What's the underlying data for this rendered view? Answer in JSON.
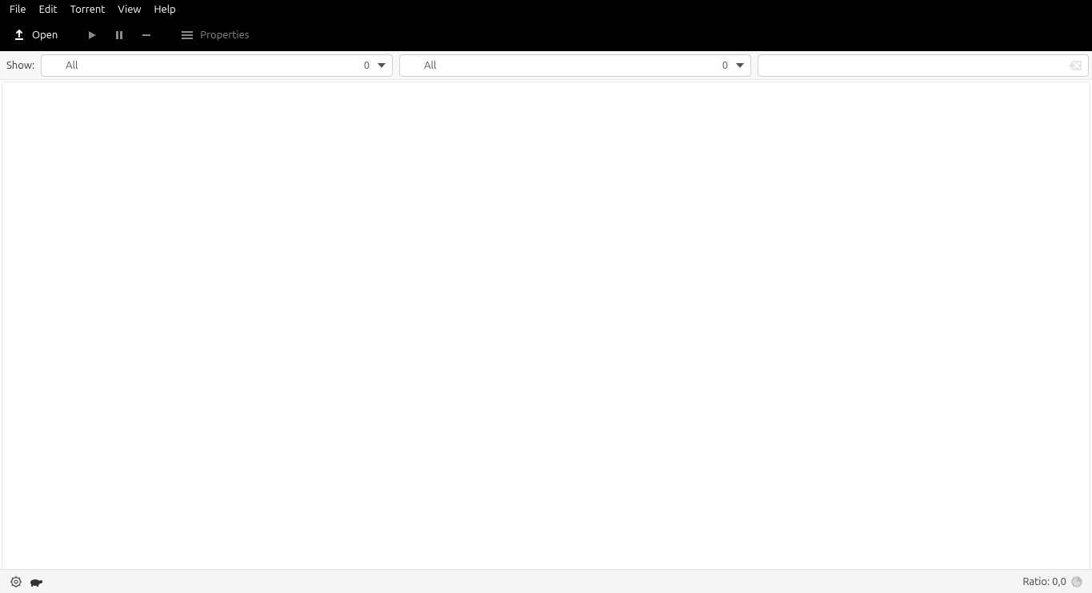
{
  "menubar": {
    "items": [
      "File",
      "Edit",
      "Torrent",
      "View",
      "Help"
    ]
  },
  "toolbar": {
    "open_label": "Open",
    "properties_label": "Properties"
  },
  "filterbar": {
    "show_label": "Show:",
    "status_filter": {
      "label": "All",
      "count": "0"
    },
    "tracker_filter": {
      "label": "All",
      "count": "0"
    },
    "search_value": ""
  },
  "statusbar": {
    "ratio_label": "Ratio: 0,0"
  }
}
